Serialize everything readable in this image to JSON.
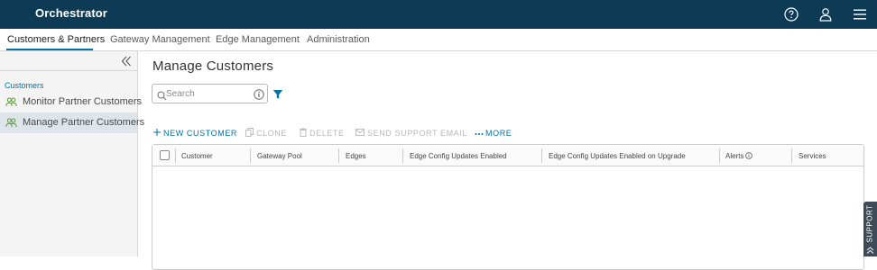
{
  "app": {
    "title": "Orchestrator"
  },
  "header_icons": [
    "help-icon",
    "user-icon",
    "menu-icon"
  ],
  "tabs": [
    {
      "label": "Customers & Partners",
      "active": true
    },
    {
      "label": "Gateway Management",
      "active": false
    },
    {
      "label": "Edge Management",
      "active": false
    },
    {
      "label": "Administration",
      "active": false
    }
  ],
  "sidebar": {
    "section_label": "Customers",
    "items": [
      {
        "label": "Monitor Partner Customers",
        "icon": "people-icon",
        "active": false
      },
      {
        "label": "Manage Partner Customers",
        "icon": "people-icon",
        "active": true
      }
    ]
  },
  "main": {
    "title": "Manage Customers",
    "search": {
      "placeholder": "Search",
      "value": ""
    }
  },
  "toolbar": {
    "new_customer": "NEW CUSTOMER",
    "clone": "CLONE",
    "delete": "DELETE",
    "send_support_email": "SEND SUPPORT EMAIL",
    "more": "MORE"
  },
  "grid": {
    "columns": [
      "Customer",
      "Gateway Pool",
      "Edges",
      "Edge Config Updates Enabled",
      "Edge Config Updates Enabled on Upgrade",
      "Alerts",
      "Services"
    ],
    "rows": []
  },
  "support_tab": {
    "label": "SUPPORT"
  },
  "colors": {
    "header_bg": "#0d3a55",
    "accent": "#0072a3",
    "sidebar_bg": "#f4f4f4",
    "sidebar_active": "#dde4ea",
    "support_bg": "#3c4b57"
  }
}
